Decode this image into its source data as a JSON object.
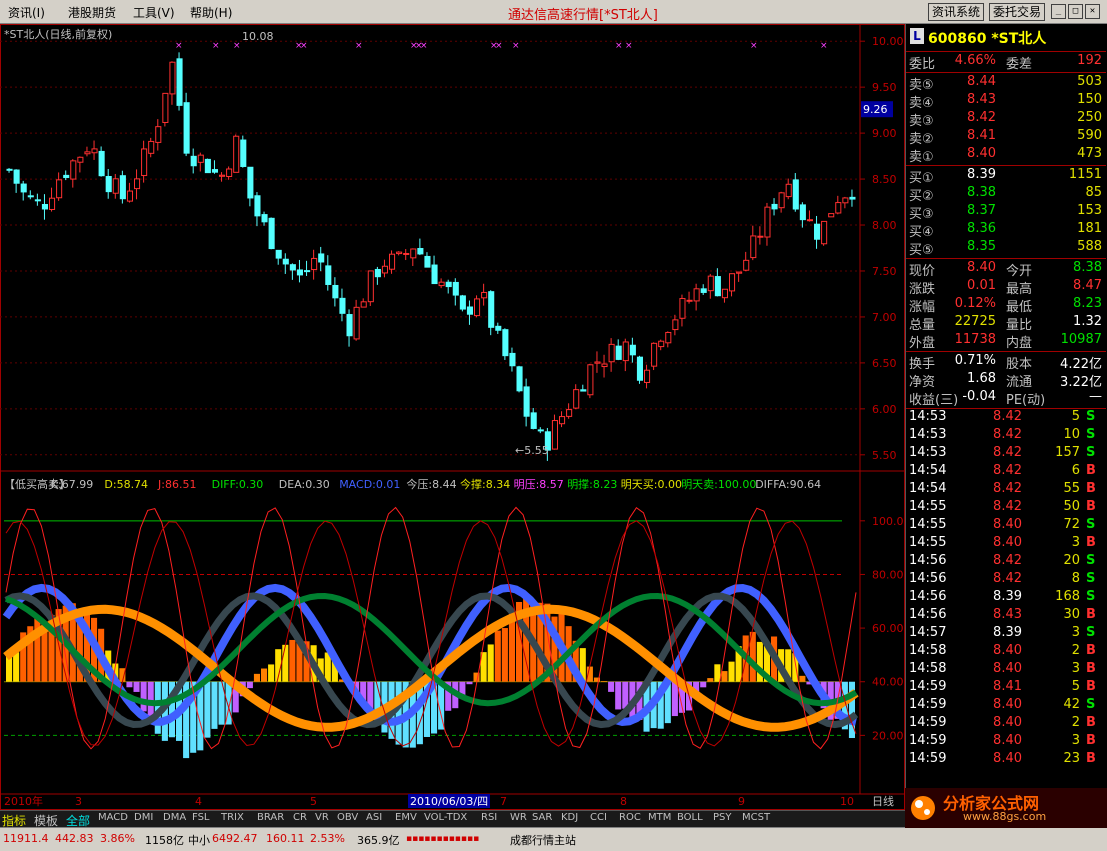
{
  "menu": {
    "items": [
      "资讯(I)",
      "港股期货",
      "工具(V)",
      "帮助(H)"
    ],
    "title": "通达信高速行情",
    "title_stock": "[*ST北人]",
    "btn_info": "资讯系统",
    "btn_trade": "委托交易"
  },
  "chart": {
    "title": "*ST北人(日线,前复权)",
    "high_label": "10.08",
    "low_label": "5.55",
    "current_price_label": "9.26",
    "price_ticks": [
      "10.00",
      "9.50",
      "9.00",
      "8.50",
      "8.00",
      "7.50",
      "7.00",
      "6.50",
      "6.00",
      "5.50"
    ],
    "indicator_ticks": [
      "100.0",
      "80.00",
      "60.00",
      "40.00",
      "20.00"
    ],
    "date_labels": [
      "2010年",
      "3",
      "4",
      "5",
      "2010/06/03/四",
      "7",
      "8",
      "9",
      "10"
    ],
    "period_label": "日线",
    "indicator_header": [
      {
        "text": "【低买高卖】",
        "color": "#c0c0c0"
      },
      {
        "text": "K:67.99",
        "color": "#c0c0c0"
      },
      {
        "text": "D:58.74",
        "color": "#e0e000"
      },
      {
        "text": "J:86.51",
        "color": "#ff3030"
      },
      {
        "text": "DIFF:0.30",
        "color": "#00e000"
      },
      {
        "text": "DEA:0.30",
        "color": "#c0c0c0"
      },
      {
        "text": "MACD:0.01",
        "color": "#4060ff"
      },
      {
        "text": "今压:8.44",
        "color": "#c0c0c0"
      },
      {
        "text": "今撑:8.34",
        "color": "#e0e000"
      },
      {
        "text": "明压:8.57",
        "color": "#ff40ff"
      },
      {
        "text": "明撑:8.23",
        "color": "#00e000"
      },
      {
        "text": "明天买:0.00",
        "color": "#e0e000"
      },
      {
        "text": "明天卖:100.00",
        "color": "#00e000"
      },
      {
        "text": "DIFFA:90.64",
        "color": "#c0c0c0"
      }
    ]
  },
  "chart_data": {
    "type": "candlestick",
    "title": "*ST北人(日线,前复权)",
    "ylim": [
      5.4,
      10.1
    ],
    "price_high": 10.08,
    "price_low": 5.55,
    "approx_close_path": [
      8.6,
      8.3,
      8.2,
      8.5,
      8.7,
      8.9,
      8.5,
      8.3,
      8.6,
      9.0,
      9.8,
      8.8,
      8.7,
      8.5,
      8.9,
      8.2,
      7.9,
      7.6,
      7.4,
      7.7,
      7.2,
      6.9,
      7.3,
      7.6,
      7.6,
      7.8,
      7.5,
      7.3,
      7.0,
      7.3,
      6.8,
      6.4,
      5.9,
      5.6,
      5.9,
      6.2,
      6.5,
      6.6,
      6.7,
      6.4,
      6.8,
      7.0,
      7.2,
      7.4,
      7.3,
      7.5,
      7.8,
      8.2,
      8.5,
      8.1,
      7.9,
      8.3,
      8.4
    ],
    "indicator": {
      "name": "低买高卖",
      "K": 67.99,
      "D": 58.74,
      "J": 86.51,
      "DIFF": 0.3,
      "DEA": 0.3,
      "MACD": 0.01,
      "DIFFA": 90.64,
      "ylim": [
        0,
        110
      ],
      "levels": [
        100,
        80,
        40,
        20
      ]
    }
  },
  "bottombar": {
    "tabs": [
      "指标",
      "模板",
      "全部",
      "MACD",
      "DMI",
      "DMA",
      "FSL",
      "TRIX",
      "BRAR",
      "CR",
      "VR",
      "OBV",
      "ASI",
      "EMV",
      "VOL-TDX",
      "RSI",
      "WR",
      "SAR",
      "KDJ",
      "CCI",
      "ROC",
      "MTM",
      "BOLL",
      "PSY",
      "MCST"
    ]
  },
  "statusbar": {
    "sh_index": "11911.4",
    "sh_change": "442.83",
    "sh_pct": "3.86%",
    "sh_amount": "1158亿",
    "zx_label": "中小",
    "zx_index": "6492.47",
    "zx_change": "160.11",
    "zx_pct": "2.53%",
    "zx_amount": "365.9亿",
    "station": "成都行情主站"
  },
  "quote": {
    "badge": "L",
    "code_name": "600860 *ST北人",
    "weibi_label": "委比",
    "weibi": "4.66%",
    "weicha_label": "委差",
    "weicha": "192",
    "asks": [
      {
        "label": "卖⑤",
        "price": "8.44",
        "vol": "503"
      },
      {
        "label": "卖④",
        "price": "8.43",
        "vol": "150"
      },
      {
        "label": "卖③",
        "price": "8.42",
        "vol": "250"
      },
      {
        "label": "卖②",
        "price": "8.41",
        "vol": "590"
      },
      {
        "label": "卖①",
        "price": "8.40",
        "vol": "473"
      }
    ],
    "bids": [
      {
        "label": "买①",
        "price": "8.39",
        "vol": "1151"
      },
      {
        "label": "买②",
        "price": "8.38",
        "vol": "85"
      },
      {
        "label": "买③",
        "price": "8.37",
        "vol": "153"
      },
      {
        "label": "买④",
        "price": "8.36",
        "vol": "181"
      },
      {
        "label": "买⑤",
        "price": "8.35",
        "vol": "588"
      }
    ],
    "stats": [
      {
        "l1": "现价",
        "v1": "8.40",
        "c1": "red",
        "l2": "今开",
        "v2": "8.38",
        "c2": "green"
      },
      {
        "l1": "涨跌",
        "v1": "0.01",
        "c1": "red",
        "l2": "最高",
        "v2": "8.47",
        "c2": "red"
      },
      {
        "l1": "涨幅",
        "v1": "0.12%",
        "c1": "red",
        "l2": "最低",
        "v2": "8.23",
        "c2": "green"
      },
      {
        "l1": "总量",
        "v1": "22725",
        "c1": "yellow",
        "l2": "量比",
        "v2": "1.32",
        "c2": "white"
      },
      {
        "l1": "外盘",
        "v1": "11738",
        "c1": "red",
        "l2": "内盘",
        "v2": "10987",
        "c2": "green"
      },
      {
        "l1": "换手",
        "v1": "0.71%",
        "c1": "white",
        "l2": "股本",
        "v2": "4.22亿",
        "c2": "white"
      },
      {
        "l1": "净资",
        "v1": "1.68",
        "c1": "white",
        "l2": "流通",
        "v2": "3.22亿",
        "c2": "white"
      },
      {
        "l1": "收益(三)",
        "v1": "-0.04",
        "c1": "white",
        "l2": "PE(动)",
        "v2": "—",
        "c2": "white"
      }
    ],
    "ticks": [
      {
        "time": "14:53",
        "price": "8.42",
        "pc": "red",
        "vol": "5",
        "bs": "S",
        "bc": "green"
      },
      {
        "time": "14:53",
        "price": "8.42",
        "pc": "red",
        "vol": "10",
        "bs": "S",
        "bc": "green"
      },
      {
        "time": "14:53",
        "price": "8.42",
        "pc": "red",
        "vol": "157",
        "bs": "S",
        "bc": "green"
      },
      {
        "time": "14:54",
        "price": "8.42",
        "pc": "red",
        "vol": "6",
        "bs": "B",
        "bc": "red"
      },
      {
        "time": "14:54",
        "price": "8.42",
        "pc": "red",
        "vol": "55",
        "bs": "B",
        "bc": "red"
      },
      {
        "time": "14:55",
        "price": "8.42",
        "pc": "red",
        "vol": "50",
        "bs": "B",
        "bc": "red"
      },
      {
        "time": "14:55",
        "price": "8.40",
        "pc": "red",
        "vol": "72",
        "bs": "S",
        "bc": "green"
      },
      {
        "time": "14:55",
        "price": "8.40",
        "pc": "red",
        "vol": "3",
        "bs": "B",
        "bc": "red"
      },
      {
        "time": "14:56",
        "price": "8.42",
        "pc": "red",
        "vol": "20",
        "bs": "S",
        "bc": "green"
      },
      {
        "time": "14:56",
        "price": "8.42",
        "pc": "red",
        "vol": "8",
        "bs": "S",
        "bc": "green"
      },
      {
        "time": "14:56",
        "price": "8.39",
        "pc": "white",
        "vol": "168",
        "bs": "S",
        "bc": "green"
      },
      {
        "time": "14:56",
        "price": "8.43",
        "pc": "red",
        "vol": "30",
        "bs": "B",
        "bc": "red"
      },
      {
        "time": "14:57",
        "price": "8.39",
        "pc": "white",
        "vol": "3",
        "bs": "S",
        "bc": "green"
      },
      {
        "time": "14:58",
        "price": "8.40",
        "pc": "red",
        "vol": "2",
        "bs": "B",
        "bc": "red"
      },
      {
        "time": "14:58",
        "price": "8.40",
        "pc": "red",
        "vol": "3",
        "bs": "B",
        "bc": "red"
      },
      {
        "time": "14:59",
        "price": "8.41",
        "pc": "red",
        "vol": "5",
        "bs": "B",
        "bc": "red"
      },
      {
        "time": "14:59",
        "price": "8.40",
        "pc": "red",
        "vol": "42",
        "bs": "S",
        "bc": "green"
      },
      {
        "time": "14:59",
        "price": "8.40",
        "pc": "red",
        "vol": "2",
        "bs": "B",
        "bc": "red"
      },
      {
        "time": "14:59",
        "price": "8.40",
        "pc": "red",
        "vol": "3",
        "bs": "B",
        "bc": "red"
      },
      {
        "time": "14:59",
        "price": "8.40",
        "pc": "red",
        "vol": "23",
        "bs": "B",
        "bc": "red"
      }
    ]
  },
  "logo": {
    "text": "分析家公式网",
    "url": "www.88gs.com"
  }
}
